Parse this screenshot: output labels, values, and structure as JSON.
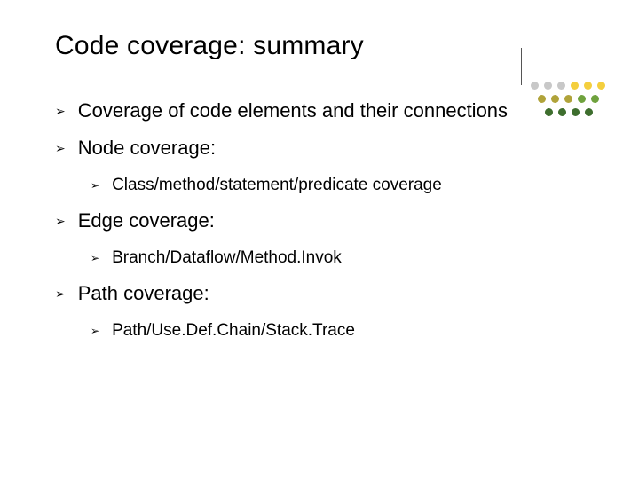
{
  "title": "Code coverage: summary",
  "bullets": [
    {
      "text": "Coverage of code elements and their connections",
      "children": []
    },
    {
      "text": "Node coverage:",
      "children": [
        {
          "text": "Class/method/statement/predicate coverage"
        }
      ]
    },
    {
      "text": "Edge coverage:",
      "children": [
        {
          "text": "Branch/Dataflow/Method.Invok"
        }
      ]
    },
    {
      "text": "Path coverage:",
      "children": [
        {
          "text": "Path/Use.Def.Chain/Stack.Trace"
        }
      ]
    }
  ],
  "bullet_glyph": "➢"
}
